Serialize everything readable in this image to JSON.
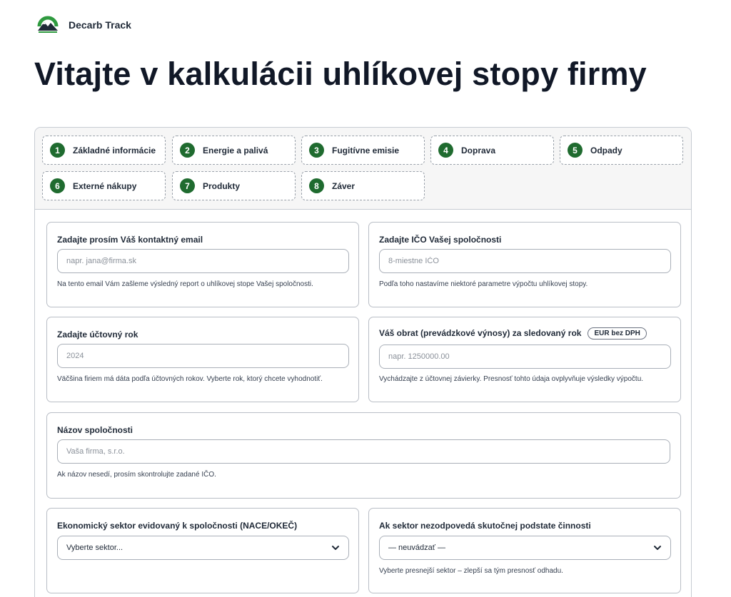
{
  "app": {
    "brand_name": "Decarb Track",
    "logo_text": "DECARB TRACK",
    "accent_color": "#1f6b2f"
  },
  "page": {
    "title": "Vitajte v kalkulácii uhlíkovej stopy firmy"
  },
  "steps": [
    {
      "num": "1",
      "label": "Základné informácie"
    },
    {
      "num": "2",
      "label": "Energie a palivá"
    },
    {
      "num": "3",
      "label": "Fugitívne emisie"
    },
    {
      "num": "4",
      "label": "Doprava"
    },
    {
      "num": "5",
      "label": "Odpady"
    },
    {
      "num": "6",
      "label": "Externé nákupy"
    },
    {
      "num": "7",
      "label": "Produkty"
    },
    {
      "num": "8",
      "label": "Záver"
    }
  ],
  "fields": {
    "email": {
      "label": "Zadajte prosím Váš kontaktný email",
      "placeholder": "napr. jana@firma.sk",
      "value": "",
      "help": "Na tento email Vám zašleme výsledný report o uhlíkovej stope Vašej spoločnosti."
    },
    "ico": {
      "label": "Zadajte IČO Vašej spoločnosti",
      "placeholder": "8-miestne IČO",
      "value": "",
      "help": "Podľa toho nastavíme niektoré parametre výpočtu uhlíkovej stopy."
    },
    "year": {
      "label": "Zadajte účtovný rok",
      "placeholder": "2024",
      "value": "",
      "help": "Väčšina firiem má dáta podľa účtovných rokov. Vyberte rok, ktorý chcete vyhodnotiť."
    },
    "turnover": {
      "label": "Váš obrat (prevádzkové výnosy) za sledovaný rok",
      "badge": "EUR bez DPH",
      "placeholder": "napr. 1250000.00",
      "value": "",
      "help": "Vychádzajte z účtovnej závierky. Presnosť tohto údaja ovplyvňuje výsledky výpočtu."
    },
    "company_name": {
      "label": "Názov spoločnosti",
      "placeholder": "Vaša firma, s.r.o.",
      "value": "",
      "help": "Ak názov nesedí, prosím skontrolujte zadané IČO."
    },
    "sector": {
      "label": "Ekonomický sektor evidovaný k spoločnosti (NACE/OKEČ)",
      "selected": "Vyberte sektor..."
    },
    "sector_override": {
      "label": "Ak sektor nezodpovedá skutočnej podstate činnosti",
      "selected": "— neuvádzať —",
      "help": "Vyberte presnejší sektor – zlepší sa tým presnosť odhadu."
    }
  }
}
